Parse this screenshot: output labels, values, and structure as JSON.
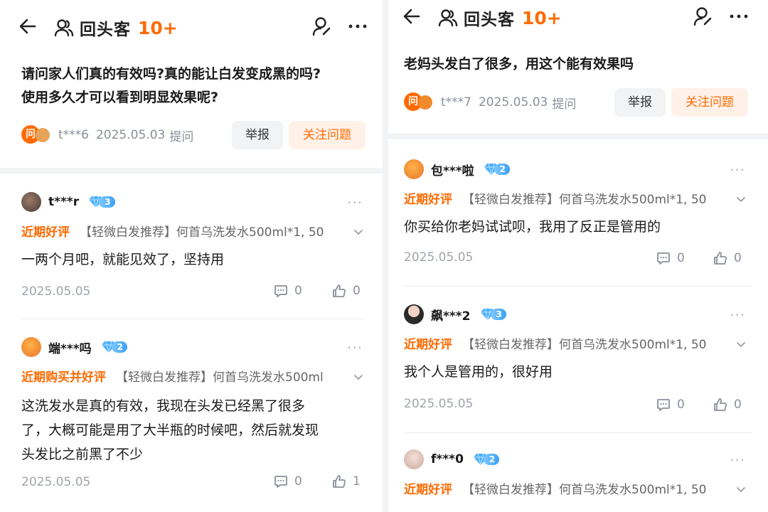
{
  "left": {
    "header": {
      "title": "回头客",
      "count": "10+"
    },
    "question": {
      "lines": [
        "请问家人们真的有效吗?真的能让白发变成黑的吗?",
        "使用多久才可以看到明显效果呢?"
      ],
      "avatar_badge": "问",
      "user": "t***6",
      "date": "2025.05.03",
      "action": "提问",
      "report_label": "举报",
      "follow_label": "关注问题"
    },
    "comments": [
      {
        "user": "t***r",
        "level": "3",
        "tag": "近期好评",
        "product": "【轻微白发推荐】何首乌洗发水500ml*1, 50",
        "lines": [
          "一两个月吧，就能见效了，坚持用"
        ],
        "date": "2025.05.05",
        "replies": "0",
        "likes": "0"
      },
      {
        "user": "端***吗",
        "level": "2",
        "tag": "近期购买并好评",
        "product": "【轻微白发推荐】何首乌洗发水500ml",
        "lines": [
          "这洗发水是真的有效，我现在头发已经黑了很多",
          "了，大概可能是用了大半瓶的时候吧，然后就发现",
          "头发比之前黑了不少"
        ],
        "date": "2025.05.05",
        "replies": "0",
        "likes": "1"
      }
    ]
  },
  "right": {
    "header": {
      "title": "回头客",
      "count": "10+"
    },
    "question": {
      "lines": [
        "老妈头发白了很多，用这个能有效果吗"
      ],
      "avatar_badge": "问",
      "user": "t***7",
      "date": "2025.05.03",
      "action": "提问",
      "report_label": "举报",
      "follow_label": "关注问题"
    },
    "comments": [
      {
        "user": "包***啦",
        "level": "2",
        "tag": "近期好评",
        "product": "【轻微白发推荐】何首乌洗发水500ml*1, 50",
        "lines": [
          "你买给你老妈试试呗，我用了反正是管用的"
        ],
        "date": "2025.05.05",
        "replies": "0",
        "likes": "0"
      },
      {
        "user": "飙***2",
        "level": "3",
        "tag": "近期好评",
        "product": "【轻微白发推荐】何首乌洗发水500ml*1, 50",
        "lines": [
          "我个人是管用的，很好用"
        ],
        "date": "2025.05.05",
        "replies": "0",
        "likes": "0"
      },
      {
        "user": "f***0",
        "level": "2",
        "tag": "近期好评",
        "product": "【轻微白发推荐】何首乌洗发水500ml*1, 50"
      }
    ]
  },
  "colors": {
    "accent": "#ff6a00",
    "muted": "#8a8f99",
    "follow_bg": "#fff1e8",
    "report_bg": "#f2f3f5"
  },
  "icons": [
    "back-arrow-icon",
    "users-icon",
    "ask-question-icon",
    "more-icon",
    "diamond-icon",
    "chevron-down-icon",
    "comment-icon",
    "thumb-up-icon"
  ]
}
